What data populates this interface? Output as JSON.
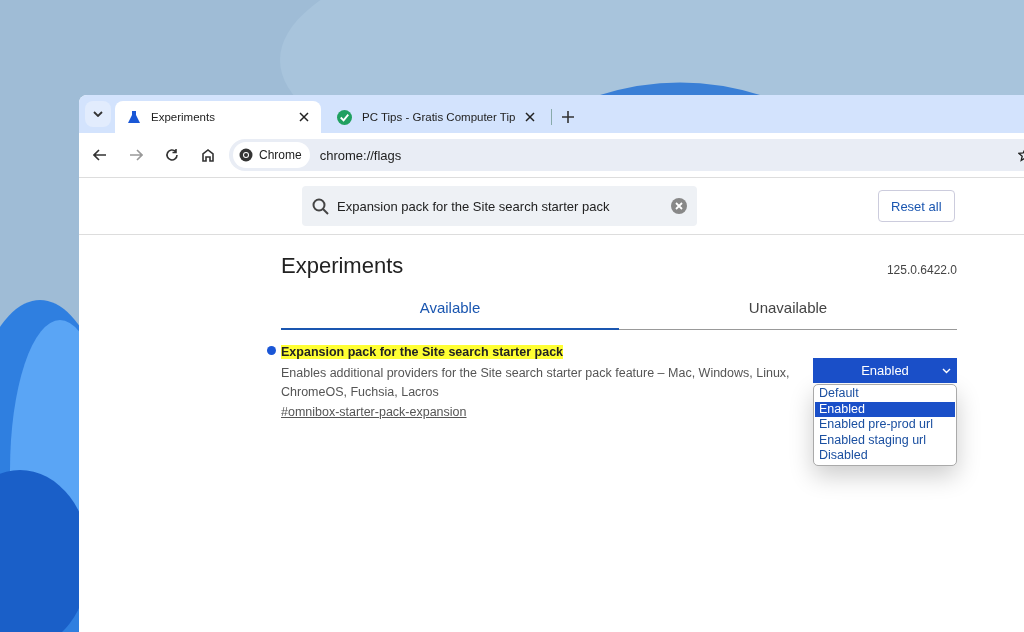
{
  "tabs": [
    {
      "title": "Experiments",
      "selected": true
    },
    {
      "title": "PC Tips - Gratis Computer Tip",
      "selected": false
    }
  ],
  "address_bar": {
    "chip": "Chrome",
    "url": "chrome://flags"
  },
  "search": {
    "value": "Expansion pack for the Site search starter pack"
  },
  "reset_button": "Reset all",
  "page": {
    "title": "Experiments",
    "version": "125.0.6422.0"
  },
  "page_tabs": [
    {
      "label": "Available",
      "selected": true
    },
    {
      "label": "Unavailable",
      "selected": false
    }
  ],
  "flag": {
    "title": "Expansion pack for the Site search starter pack",
    "description": "Enables additional providers for the Site search starter pack feature – Mac, Windows, Linux, ChromeOS, Fuchsia, Lacros",
    "link": "#omnibox-starter-pack-expansion",
    "value": "Enabled",
    "options": [
      {
        "label": "Default",
        "selected": false
      },
      {
        "label": "Enabled",
        "selected": true
      },
      {
        "label": "Enabled pre-prod url",
        "selected": false
      },
      {
        "label": "Enabled staging url",
        "selected": false
      },
      {
        "label": "Disabled",
        "selected": false
      }
    ]
  }
}
